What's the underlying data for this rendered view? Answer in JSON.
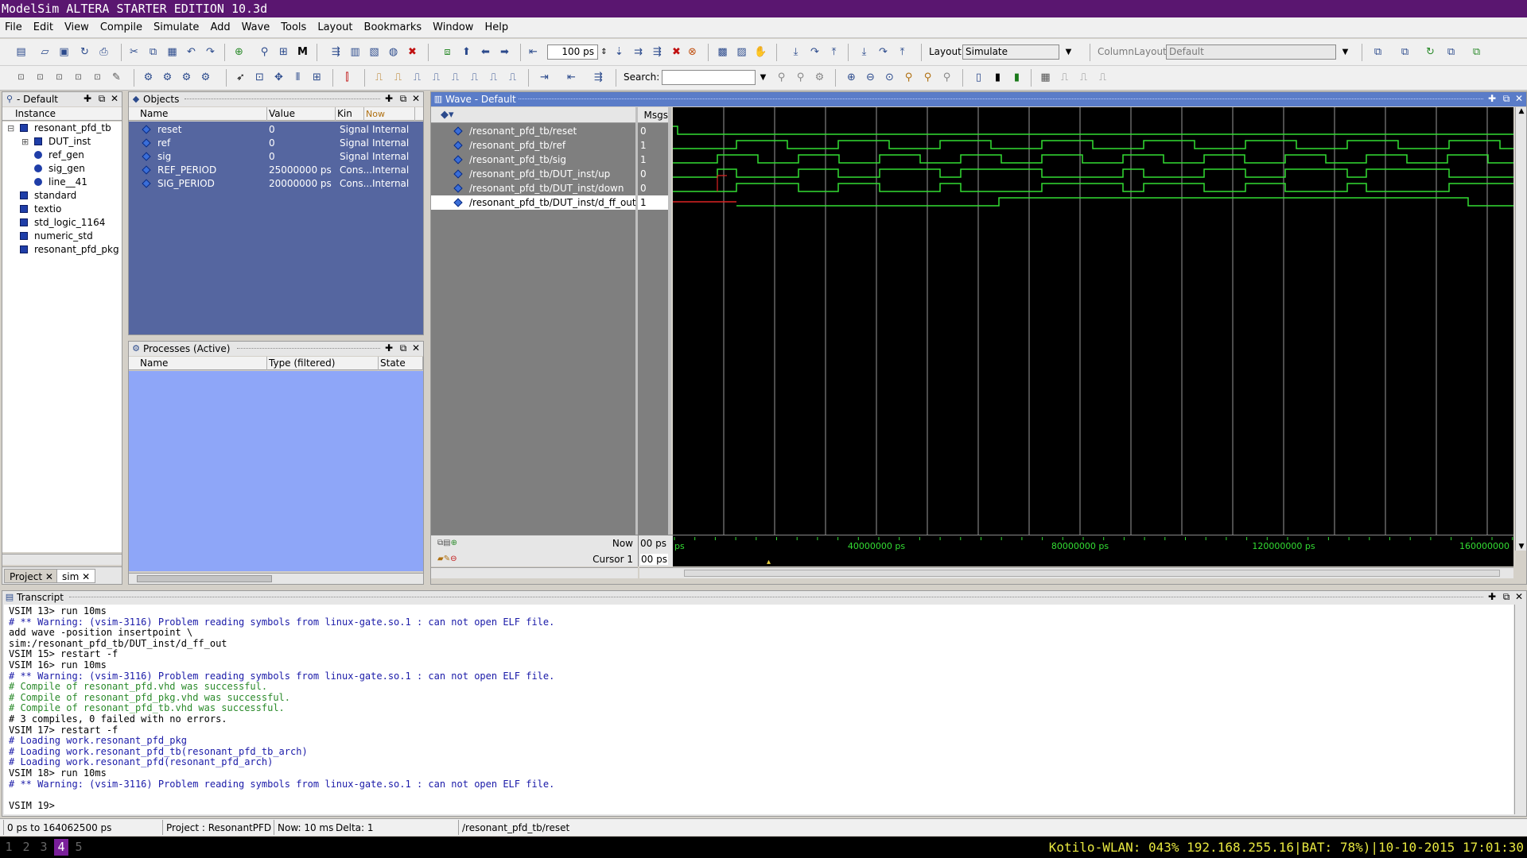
{
  "window": {
    "title": "ModelSim ALTERA STARTER EDITION 10.3d"
  },
  "menu": [
    "File",
    "Edit",
    "View",
    "Compile",
    "Simulate",
    "Add",
    "Wave",
    "Tools",
    "Layout",
    "Bookmarks",
    "Window",
    "Help"
  ],
  "toolbar": {
    "run_length_value": "100 ps",
    "layout_label": "Layout",
    "layout_value": "Simulate",
    "column_layout_label": "ColumnLayout",
    "column_layout_value": "Default",
    "search_label": "Search:",
    "search_value": ""
  },
  "sim_panel": {
    "title": "- Default",
    "col_instance": "Instance",
    "items": [
      {
        "label": "resonant_pfd_tb",
        "icon": "block-icon",
        "indent": 0,
        "toggle": "-"
      },
      {
        "label": "DUT_inst",
        "icon": "block-icon",
        "indent": 1,
        "toggle": "+"
      },
      {
        "label": "ref_gen",
        "icon": "process-icon",
        "indent": 1,
        "toggle": ""
      },
      {
        "label": "sig_gen",
        "icon": "process-icon",
        "indent": 1,
        "toggle": ""
      },
      {
        "label": "line__41",
        "icon": "process-icon",
        "indent": 1,
        "toggle": ""
      },
      {
        "label": "standard",
        "icon": "block-icon",
        "indent": 0,
        "toggle": ""
      },
      {
        "label": "textio",
        "icon": "block-icon",
        "indent": 0,
        "toggle": ""
      },
      {
        "label": "std_logic_1164",
        "icon": "block-icon",
        "indent": 0,
        "toggle": ""
      },
      {
        "label": "numeric_std",
        "icon": "block-icon",
        "indent": 0,
        "toggle": ""
      },
      {
        "label": "resonant_pfd_pkg",
        "icon": "block-icon",
        "indent": 0,
        "toggle": ""
      }
    ],
    "tabs": [
      "Project",
      "sim"
    ]
  },
  "objects_panel": {
    "title": "Objects",
    "columns": [
      "Name",
      "Value",
      "Kin",
      "Now"
    ],
    "rows": [
      {
        "name": "reset",
        "value": "0",
        "kind": "Signal",
        "mode": "Internal"
      },
      {
        "name": "ref",
        "value": "0",
        "kind": "Signal",
        "mode": "Internal"
      },
      {
        "name": "sig",
        "value": "0",
        "kind": "Signal",
        "mode": "Internal"
      },
      {
        "name": "REF_PERIOD",
        "value": "25000000 ps",
        "kind": "Cons...",
        "mode": "Internal"
      },
      {
        "name": "SIG_PERIOD",
        "value": "20000000 ps",
        "kind": "Cons...",
        "mode": "Internal"
      }
    ]
  },
  "processes_panel": {
    "title": "Processes (Active)",
    "columns": [
      "Name",
      "Type (filtered)",
      "State"
    ]
  },
  "wave_panel": {
    "title": "Wave - Default",
    "msgs_label": "Msgs",
    "signals": [
      {
        "name": "/resonant_pfd_tb/reset",
        "value": "0"
      },
      {
        "name": "/resonant_pfd_tb/ref",
        "value": "1"
      },
      {
        "name": "/resonant_pfd_tb/sig",
        "value": "1"
      },
      {
        "name": "/resonant_pfd_tb/DUT_inst/up",
        "value": "0"
      },
      {
        "name": "/resonant_pfd_tb/DUT_inst/down",
        "value": "0"
      },
      {
        "name": "/resonant_pfd_tb/DUT_inst/d_ff_out",
        "value": "1"
      }
    ],
    "now_label": "Now",
    "now_value": "00 ps",
    "cursor_label": "Cursor 1",
    "cursor_value": "00 ps",
    "timeline_ticks": [
      "ps",
      "40000000 ps",
      "80000000 ps",
      "120000000 ps",
      "160000000"
    ],
    "colors": {
      "wave": "#33dd33",
      "undefined": "#dd2222",
      "grid": "#9a9a9a",
      "background": "#000000"
    }
  },
  "transcript": {
    "title": "Transcript",
    "lines": [
      {
        "text": "VSIM 13> run 10ms",
        "style": "prompt"
      },
      {
        "text": "# ** Warning: (vsim-3116) Problem reading symbols from linux-gate.so.1 : can not open ELF file.",
        "style": "blue"
      },
      {
        "text": "add wave -position insertpoint  \\",
        "style": "plain"
      },
      {
        "text": "sim:/resonant_pfd_tb/DUT_inst/d_ff_out",
        "style": "plain"
      },
      {
        "text": "VSIM 15> restart -f",
        "style": "prompt"
      },
      {
        "text": "VSIM 16> run 10ms",
        "style": "prompt"
      },
      {
        "text": "# ** Warning: (vsim-3116) Problem reading symbols from linux-gate.so.1 : can not open ELF file.",
        "style": "blue"
      },
      {
        "text": "# Compile of resonant_pfd.vhd was successful.",
        "style": "green"
      },
      {
        "text": "# Compile of resonant_pfd_pkg.vhd was successful.",
        "style": "green"
      },
      {
        "text": "# Compile of resonant_pfd_tb.vhd was successful.",
        "style": "green"
      },
      {
        "text": "# 3 compiles, 0 failed with no errors.",
        "style": "plain"
      },
      {
        "text": "VSIM 17> restart -f",
        "style": "prompt"
      },
      {
        "text": "# Loading work.resonant_pfd_pkg",
        "style": "blue"
      },
      {
        "text": "# Loading work.resonant_pfd_tb(resonant_pfd_tb_arch)",
        "style": "blue"
      },
      {
        "text": "# Loading work.resonant_pfd(resonant_pfd_arch)",
        "style": "blue"
      },
      {
        "text": "VSIM 18> run 10ms",
        "style": "prompt"
      },
      {
        "text": "# ** Warning: (vsim-3116) Problem reading symbols from linux-gate.so.1 : can not open ELF file.",
        "style": "blue"
      },
      {
        "text": "",
        "style": "plain"
      },
      {
        "text": "VSIM 19>",
        "style": "prompt"
      }
    ]
  },
  "status": {
    "range": "0 ps to 164062500 ps",
    "project": "Project : ResonantPFD",
    "now": "Now: 10 ms",
    "delta": "Delta: 1",
    "selected": "/resonant_pfd_tb/reset"
  },
  "wm": {
    "workspaces": [
      "1",
      "2",
      "3",
      "4",
      "5"
    ],
    "active_workspace": "4",
    "status_text": "Kotilo-WLAN: 043% 192.168.255.16|BAT: 78%)|10-10-2015 17:01:30"
  }
}
